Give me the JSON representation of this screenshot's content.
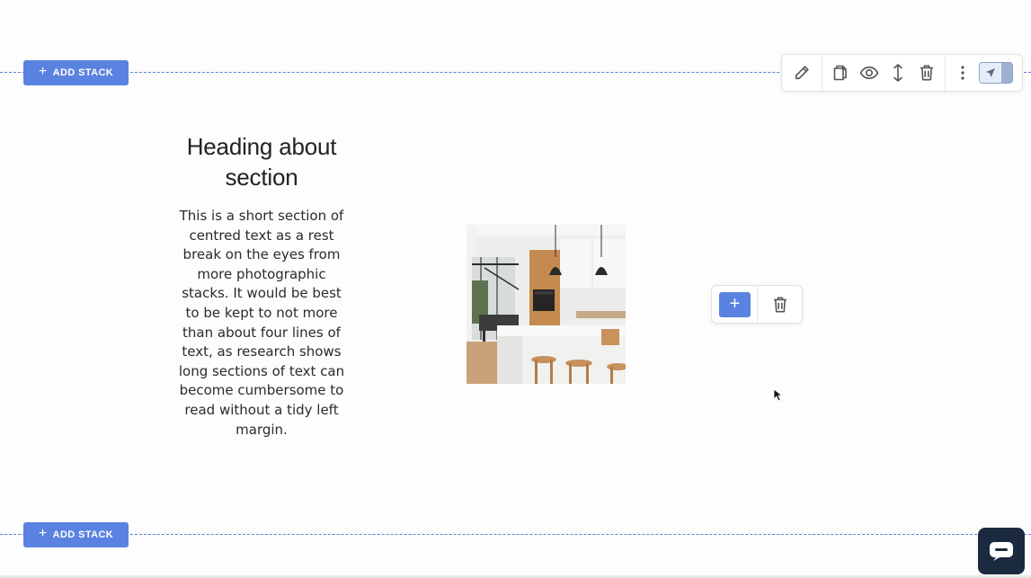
{
  "stack_controls": {
    "top_add_label": "ADD STACK",
    "bottom_add_label": "ADD STACK"
  },
  "toolbar": {
    "icons": [
      "pencil-icon",
      "copy-icon",
      "eye-icon",
      "resize-vertical-icon",
      "trash-icon",
      "more-vertical-icon",
      "toggle-switch"
    ]
  },
  "section": {
    "heading": "Heading about section",
    "body": "This is a short section of centred text as a rest break on the eyes from more photographic stacks. It would be best to be kept to not more than about four lines of text, as research shows long sections of text can become cumbersome to read without a tidy left margin."
  },
  "image_actions": {
    "add_label": "+"
  },
  "colors": {
    "accent": "#5a82e0",
    "divider": "#5b7fd8",
    "chat": "#1b2a3e"
  }
}
